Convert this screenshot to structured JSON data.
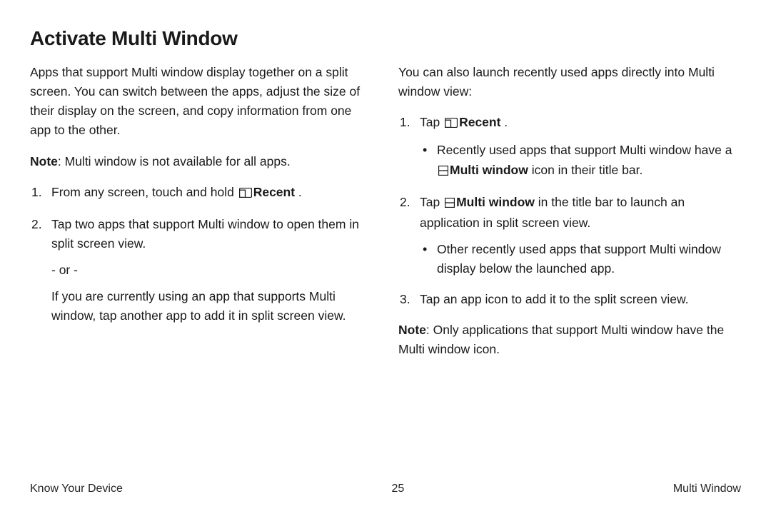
{
  "title": "Activate Multi Window",
  "left": {
    "intro": "Apps that support Multi window display together on a split screen. You can switch between the apps, adjust the size of their display on the screen, and copy information from one app to the other.",
    "note_label": "Note",
    "note_body": ": Multi window is not available for all apps.",
    "step1_pre": "From any screen, touch and hold ",
    "step1_bold": "Recent",
    "step1_post": " .",
    "step2": "Tap two apps that support Multi window to open them in split screen view.",
    "or": "‑ or ‑",
    "step2_alt": "If you are currently using an app that supports Multi window, tap another app to add it in split screen view."
  },
  "right": {
    "intro": "You can also launch recently used apps directly into Multi window view:",
    "step1_pre": "Tap ",
    "step1_bold": "Recent",
    "step1_post": " .",
    "bullet1_pre": "Recently used apps that support Multi window have a ",
    "bullet1_bold": "Multi  window",
    "bullet1_post": " icon in their title bar.",
    "step2_pre": "Tap ",
    "step2_bold": "Multi  window",
    "step2_post": " in the title bar to launch an application in split screen view.",
    "bullet2": "Other recently used apps that support Multi window display below the launched app.",
    "step3": "Tap an app icon to add it to the split screen view.",
    "note_label": "Note",
    "note_body": ": Only applications that support Multi window have the Multi window icon."
  },
  "footer": {
    "left": "Know Your Device",
    "center": "25",
    "right": "Multi Window"
  }
}
